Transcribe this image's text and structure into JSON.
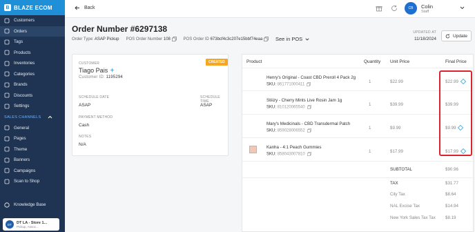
{
  "brand": {
    "name": "BLAZE ECOM",
    "logo_letter": "B"
  },
  "sidebar": {
    "items": [
      {
        "label": "Customers",
        "icon": "users-icon",
        "active": false
      },
      {
        "label": "Orders",
        "icon": "cart-icon",
        "active": true
      },
      {
        "label": "Tags",
        "icon": "tag-icon",
        "active": false
      },
      {
        "label": "Products",
        "icon": "box-icon",
        "active": false
      },
      {
        "label": "Inventories",
        "icon": "inventory-icon",
        "active": false
      },
      {
        "label": "Categories",
        "icon": "folder-icon",
        "active": false
      },
      {
        "label": "Brands",
        "icon": "brand-icon",
        "active": false
      },
      {
        "label": "Discounts",
        "icon": "discount-icon",
        "active": false
      },
      {
        "label": "Settings",
        "icon": "gear-icon",
        "active": false
      }
    ],
    "section_title": "SALES CHANNELS",
    "channel_items": [
      {
        "label": "General",
        "icon": "globe-icon"
      },
      {
        "label": "Pages",
        "icon": "page-icon"
      },
      {
        "label": "Theme",
        "icon": "palette-icon"
      },
      {
        "label": "Banners",
        "icon": "banner-icon"
      },
      {
        "label": "Campaigns",
        "icon": "megaphone-icon"
      },
      {
        "label": "Scan to Shop",
        "icon": "qr-icon"
      }
    ],
    "kb_label": "Knowledge Base",
    "store": {
      "avatar": "DT",
      "name": "DT LA - Store 1...",
      "sub": "Pickup, Assoc..."
    }
  },
  "topbar": {
    "back_label": "Back",
    "user_initials": "CB",
    "user_name": "Colin",
    "user_role": "Staff"
  },
  "order": {
    "title": "Order Number #6297138",
    "type_label": "Order Type:",
    "type_value": "ASAP Pickup",
    "pos_number_label": "POS Order Number",
    "pos_number_value": "108",
    "pos_id_label": "POS Order ID",
    "pos_id_value": "673bcf4c3c207e15bbf74eaa",
    "see_in_pos": "See in POS",
    "updated_label": "UPDATED AT",
    "updated_date": "11/18/2024",
    "update_button": "Update"
  },
  "customer": {
    "section_label": "CUSTOMER",
    "badge": "CREATED",
    "name": "Tiago Pais",
    "id_label": "Customer ID:",
    "id_value": "1195294",
    "schedule_date_label": "SCHEDULE DATE",
    "schedule_date_value": "ASAP",
    "schedule_time_label": "SCHEDULE TIME",
    "schedule_time_value": "ASAP",
    "payment_label": "PAYMENT METHOD",
    "payment_value": "Cash",
    "notes_label": "NOTES",
    "notes_value": "N/A"
  },
  "products": {
    "headers": {
      "product": "Product",
      "quantity": "Quantity",
      "unit_price": "Unit Price",
      "final_price": "Final Price"
    },
    "sku_label": "SKU:",
    "rows": [
      {
        "name": "Henry's Original - Coast CBD Preroll 4 Pack 2g",
        "sku": "861771000411",
        "qty": "1",
        "unit": "$22.99",
        "final": "$22.99",
        "discount_icon": true,
        "thumb": false
      },
      {
        "name": "Stiiizy - Cherry Mints Live Rosin Jam 1g",
        "sku": "810120065540",
        "qty": "1",
        "unit": "$39.99",
        "final": "$39.99",
        "discount_icon": false,
        "thumb": false
      },
      {
        "name": "Mary's Medicinals - CBD Transdermal Patch",
        "sku": "859028006552",
        "qty": "1",
        "unit": "$9.99",
        "final": "$9.99",
        "discount_icon": true,
        "thumb": false
      },
      {
        "name": "Kanha - 4:1 Peach Gummies",
        "sku": "858043007810",
        "qty": "1",
        "unit": "$17.99",
        "final": "$17.99",
        "discount_icon": true,
        "thumb": true
      }
    ],
    "summary": [
      {
        "label": "SUBTOTAL",
        "value": "$90.96",
        "bold": true
      },
      {
        "label": "TAX",
        "value": "$31.77",
        "bold": true
      },
      {
        "label": "City Tax",
        "value": "$8.64",
        "bold": false
      },
      {
        "label": "NAL Excise Tax",
        "value": "$14.94",
        "bold": false
      },
      {
        "label": "New York Sales Tax Tax",
        "value": "$8.19",
        "bold": false
      }
    ]
  },
  "colors": {
    "sidebar": "#1f3352",
    "brand": "#1f8fd8",
    "badge": "#f5a623",
    "highlight": "#d9232d",
    "accent": "#4fb3e8"
  }
}
